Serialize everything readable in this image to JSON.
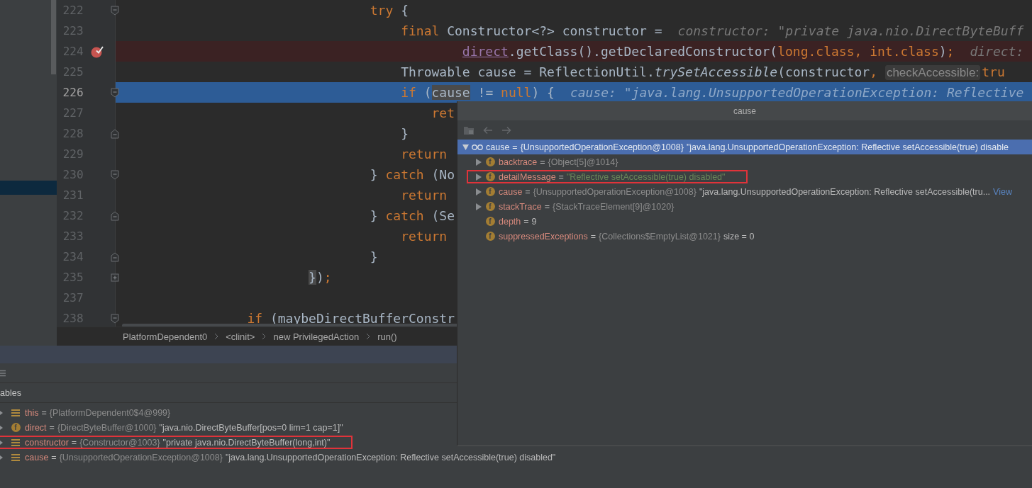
{
  "sidebar": {
    "rows": [
      {
        "selected": false
      },
      {
        "selected": false
      },
      {
        "selected": false
      },
      {
        "selected": false
      },
      {
        "selected": false
      },
      {
        "selected": false
      },
      {
        "selected": false
      },
      {
        "selected": false
      },
      {
        "selected": false
      },
      {
        "selected": false
      },
      {
        "selected": false
      },
      {
        "selected": false
      },
      {
        "selected": true
      }
    ]
  },
  "editor": {
    "lines": [
      {
        "number": "222",
        "fold": {
          "kind": "open"
        },
        "breakpoint": false,
        "current": false,
        "segments": [
          {
            "kind": "keyword",
            "text": "                                try"
          },
          {
            "kind": "plain",
            "text": " {"
          }
        ]
      },
      {
        "number": "223",
        "breakpoint": false,
        "current": false,
        "segments": [
          {
            "kind": "keyword",
            "text": "                                    final"
          },
          {
            "kind": "plain",
            "text": " Constructor<?> constructor ="
          },
          {
            "kind": "hint",
            "text": "constructor: \"private java.nio.DirectByteBuff"
          }
        ]
      },
      {
        "number": "224",
        "breakpoint": true,
        "current": false,
        "segments": [
          {
            "kind": "field",
            "text": "                                            direct"
          },
          {
            "kind": "plain",
            "text": ".getClass().getDeclaredConstructor("
          },
          {
            "kind": "keyword",
            "text": "long.class, int.class"
          },
          {
            "kind": "plain",
            "text": ")"
          },
          {
            "kind": "keyword",
            "text": ";"
          },
          {
            "kind": "hint",
            "text": "direct:"
          }
        ]
      },
      {
        "number": "225",
        "breakpoint": false,
        "current": false,
        "segments": [
          {
            "kind": "plain",
            "text": "                                    Throwable cause = ReflectionUtil."
          },
          {
            "kind": "static",
            "text": "trySetAccessible"
          },
          {
            "kind": "plain",
            "text": "(constructor"
          },
          {
            "kind": "keyword",
            "text": ", "
          },
          {
            "kind": "param",
            "text": "checkAccessible:"
          },
          {
            "kind": "keyword",
            "text": "tru"
          }
        ]
      },
      {
        "number": "226",
        "fold": {
          "kind": "open"
        },
        "breakpoint": false,
        "current": true,
        "segments": [
          {
            "kind": "keyword",
            "text": "                                    if"
          },
          {
            "kind": "plain",
            "text": " ("
          },
          {
            "kind": "match",
            "text": "cause"
          },
          {
            "kind": "plain",
            "text": " != "
          },
          {
            "kind": "keyword",
            "text": "null"
          },
          {
            "kind": "plain",
            "text": ") {"
          },
          {
            "kind": "hint",
            "text": "cause: \"java.lang.UnsupportedOperationException: Reflective"
          }
        ]
      },
      {
        "number": "227",
        "breakpoint": false,
        "current": false,
        "segments": [
          {
            "kind": "keyword",
            "text": "                                        ret"
          }
        ]
      },
      {
        "number": "228",
        "fold": {
          "kind": "close"
        },
        "breakpoint": false,
        "current": false,
        "segments": [
          {
            "kind": "plain",
            "text": "                                    }"
          }
        ]
      },
      {
        "number": "229",
        "breakpoint": false,
        "current": false,
        "segments": [
          {
            "kind": "keyword",
            "text": "                                    return"
          }
        ]
      },
      {
        "number": "230",
        "fold": {
          "kind": "open"
        },
        "breakpoint": false,
        "current": false,
        "segments": [
          {
            "kind": "plain",
            "text": "                                } "
          },
          {
            "kind": "keyword",
            "text": "catch"
          },
          {
            "kind": "plain",
            "text": " (No"
          }
        ]
      },
      {
        "number": "231",
        "breakpoint": false,
        "current": false,
        "segments": [
          {
            "kind": "keyword",
            "text": "                                    return"
          }
        ]
      },
      {
        "number": "232",
        "fold": {
          "kind": "close"
        },
        "breakpoint": false,
        "current": false,
        "segments": [
          {
            "kind": "plain",
            "text": "                                } "
          },
          {
            "kind": "keyword",
            "text": "catch"
          },
          {
            "kind": "plain",
            "text": " (Se"
          }
        ]
      },
      {
        "number": "233",
        "breakpoint": false,
        "current": false,
        "segments": [
          {
            "kind": "keyword",
            "text": "                                    return"
          }
        ]
      },
      {
        "number": "234",
        "fold": {
          "kind": "close"
        },
        "breakpoint": false,
        "current": false,
        "segments": [
          {
            "kind": "plain",
            "text": "                                }"
          }
        ]
      },
      {
        "number": "235",
        "fold": {
          "kind": "collapsed"
        },
        "breakpoint": false,
        "current": false,
        "segments": [
          {
            "kind": "match",
            "text": "                        }"
          },
          {
            "kind": "plain",
            "text": ")"
          },
          {
            "kind": "keyword",
            "text": ";"
          }
        ]
      },
      {
        "number": "237",
        "breakpoint": false,
        "current": false
      },
      {
        "number": "238",
        "fold": {
          "kind": "open"
        },
        "breakpoint": false,
        "current": false,
        "segments": [
          {
            "kind": "keyword",
            "text": "                if"
          },
          {
            "kind": "plain",
            "text": " (maybeDirectBufferConstr"
          }
        ]
      }
    ]
  },
  "breadcrumbs": [
    "PlatformDependent0",
    "<clinit>",
    "new PrivilegedAction",
    "run()"
  ],
  "debug_panel": {
    "tabs": [
      {
        "label": "ables",
        "selected": true
      }
    ],
    "variables": [
      {
        "name": "this",
        "op": "=",
        "type": "{PlatformDependent0$4@999}",
        "icon": {
          "kind": "local"
        },
        "highlighted": false
      },
      {
        "name": "direct",
        "op": "=",
        "type": "{DirectByteBuffer@1000}",
        "value": "\"java.nio.DirectByteBuffer[pos=0 lim=1 cap=1]\"",
        "string_literal": false,
        "icon": {
          "kind": "field",
          "glyph": "f"
        },
        "highlighted": false
      },
      {
        "name": "constructor",
        "op": "=",
        "type": "{Constructor@1003}",
        "value": "\"private java.nio.DirectByteBuffer(long,int)\"",
        "string_literal": false,
        "icon": {
          "kind": "local"
        },
        "highlighted": true
      },
      {
        "name": "cause",
        "op": "=",
        "type": "{UnsupportedOperationException@1008}",
        "value": "\"java.lang.UnsupportedOperationException: Reflective setAccessible(true) disabled\"",
        "string_literal": false,
        "icon": {
          "kind": "local"
        },
        "highlighted": false
      }
    ]
  },
  "popup": {
    "title": "cause",
    "nodes": [
      {
        "name": "cause",
        "op": "=",
        "type": "{UnsupportedOperationException@1008}",
        "value": "\"java.lang.UnsupportedOperationException: Reflective setAccessible(true) disable",
        "string_literal": false,
        "icon": {
          "kind": "watch"
        },
        "expandable": true,
        "expanded": true,
        "selected": true,
        "highlighted": false,
        "children": [
          {
            "name": "backtrace",
            "op": "=",
            "type": "{Object[5]@1014}",
            "icon": {
              "kind": "field",
              "glyph": "f"
            },
            "expandable": true,
            "expanded": false,
            "selected": false,
            "highlighted": false
          },
          {
            "name": "detailMessage",
            "op": "=",
            "value": "\"Reflective setAccessible(true) disabled\"",
            "string_literal": true,
            "icon": {
              "kind": "field",
              "glyph": "f"
            },
            "expandable": true,
            "expanded": false,
            "selected": false,
            "highlighted": true
          },
          {
            "name": "cause",
            "op": "=",
            "type": "{UnsupportedOperationException@1008}",
            "value": "\"java.lang.UnsupportedOperationException: Reflective setAccessible(tru...",
            "string_literal": false,
            "link": "View",
            "icon": {
              "kind": "field",
              "glyph": "f"
            },
            "expandable": true,
            "expanded": false,
            "selected": false,
            "highlighted": false
          },
          {
            "name": "stackTrace",
            "op": "=",
            "type": "{StackTraceElement[9]@1020}",
            "icon": {
              "kind": "field",
              "glyph": "f"
            },
            "expandable": true,
            "expanded": false,
            "selected": false,
            "highlighted": false
          },
          {
            "name": "depth",
            "op": "=",
            "value": "9",
            "string_literal": false,
            "icon": {
              "kind": "field",
              "glyph": "f"
            },
            "expandable": false,
            "selected": false,
            "highlighted": false
          },
          {
            "name": "suppressedExceptions",
            "op": "=",
            "type": "{Collections$EmptyList@1021}",
            "value": "size = 0",
            "string_literal": false,
            "icon": {
              "kind": "field",
              "glyph": "f"
            },
            "expandable": false,
            "selected": false,
            "highlighted": false
          }
        ]
      }
    ]
  }
}
